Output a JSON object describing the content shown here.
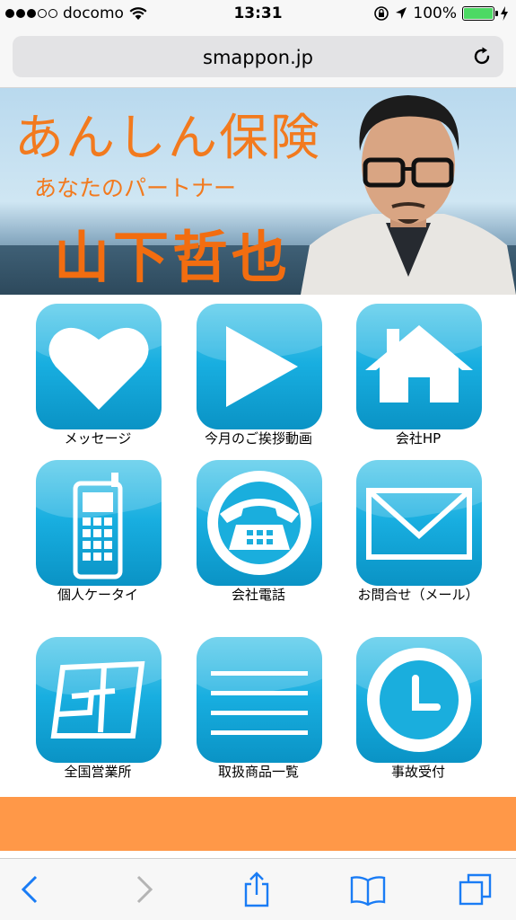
{
  "status_bar": {
    "carrier": "docomo",
    "time": "13:31",
    "battery_percent": "100%",
    "signal_bars_filled": 3,
    "signal_bars_total": 5
  },
  "browser": {
    "url": "smappon.jp"
  },
  "banner": {
    "title": "あんしん保険",
    "subtitle": "あなたのパートナー",
    "name": "山下哲也"
  },
  "menu": {
    "items": [
      {
        "label": "メッセージ",
        "icon": "heart-icon"
      },
      {
        "label": "今月のご挨拶動画",
        "icon": "play-icon"
      },
      {
        "label": "会社HP",
        "icon": "home-icon"
      },
      {
        "label": "個人ケータイ",
        "icon": "mobile-phone-icon"
      },
      {
        "label": "会社電話",
        "icon": "telephone-icon"
      },
      {
        "label": "お問合せ（メール）",
        "icon": "mail-icon"
      },
      {
        "label": "全国営業所",
        "icon": "map-icon"
      },
      {
        "label": "取扱商品一覧",
        "icon": "list-icon"
      },
      {
        "label": "事故受付",
        "icon": "clock-icon"
      }
    ]
  },
  "toolbar": {
    "items": [
      "back-icon",
      "forward-icon",
      "share-icon",
      "bookmarks-icon",
      "tabs-icon"
    ]
  },
  "colors": {
    "accent_orange": "#ff9848",
    "banner_text": "#f27a1e",
    "icon_blue": "#18aee0",
    "toolbar_blue": "#1a7cf5"
  }
}
